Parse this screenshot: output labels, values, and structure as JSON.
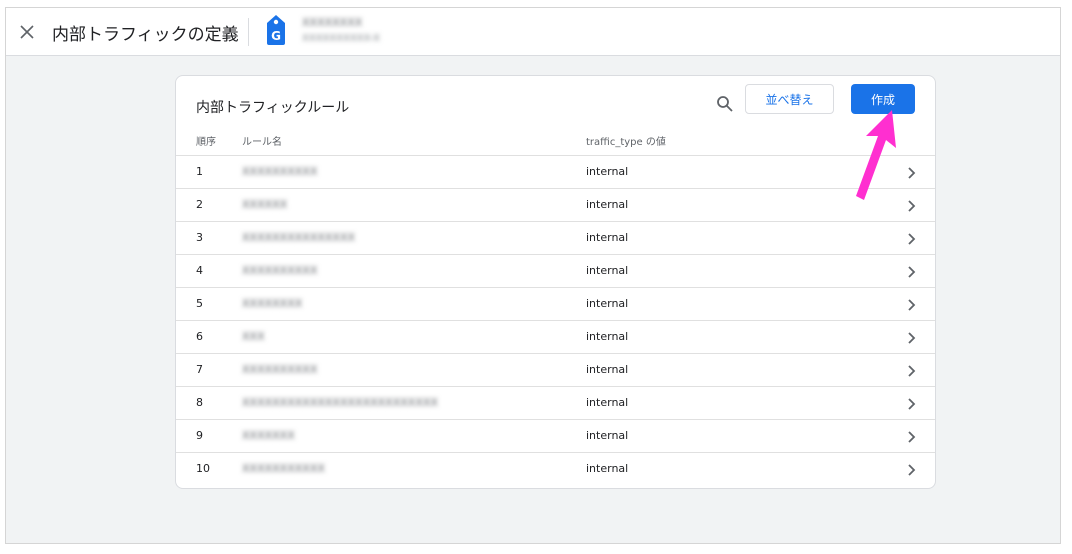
{
  "header": {
    "title": "内部トラフィックの定義",
    "account_name": "XXXXXXXX",
    "account_sub": "XXXXXXXXXX-X"
  },
  "card": {
    "title": "内部トラフィックルール",
    "sort_label": "並べ替え",
    "create_label": "作成",
    "columns": {
      "order": "順序",
      "rule_name": "ルール名",
      "traffic_type": "traffic_type の値"
    }
  },
  "rows": [
    {
      "index": "1",
      "name": "XXXXXXXXXX",
      "traffic_type": "internal"
    },
    {
      "index": "2",
      "name": "XXXXXX",
      "traffic_type": "internal"
    },
    {
      "index": "3",
      "name": "XXXXXXXXXXXXXXX",
      "traffic_type": "internal"
    },
    {
      "index": "4",
      "name": "XXXXXXXXXX",
      "traffic_type": "internal"
    },
    {
      "index": "5",
      "name": "XXXXXXXX",
      "traffic_type": "internal"
    },
    {
      "index": "6",
      "name": "XXX",
      "traffic_type": "internal"
    },
    {
      "index": "7",
      "name": "XXXXXXXXXX",
      "traffic_type": "internal"
    },
    {
      "index": "8",
      "name": "XXXXXXXXXXXXXXXXXXXXXXXXXX",
      "traffic_type": "internal"
    },
    {
      "index": "9",
      "name": "XXXXXXX",
      "traffic_type": "internal"
    },
    {
      "index": "10",
      "name": "XXXXXXXXXXX",
      "traffic_type": "internal"
    }
  ],
  "colors": {
    "accent": "#1a73e8",
    "annotation_arrow": "#ff2fd0",
    "background": "#f1f3f4"
  },
  "icons": {
    "close": "close-icon",
    "logo": "tag-manager-logo-icon",
    "search": "search-icon",
    "row_action": "chevron-right-icon"
  }
}
